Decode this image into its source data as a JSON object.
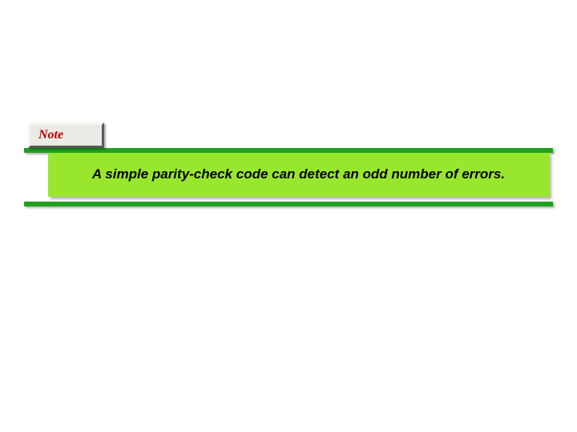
{
  "note": {
    "label": "Note"
  },
  "content": {
    "text": "A simple parity-check code can detect an odd number of errors."
  }
}
